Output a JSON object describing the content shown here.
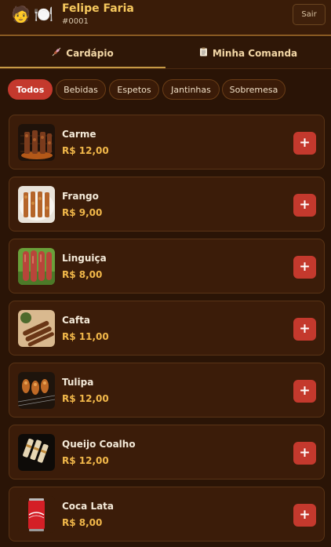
{
  "header": {
    "avatar_icon": "🧑",
    "plate_icon": "🍽️",
    "name": "Felipe Faria",
    "id": "#0001",
    "logout_label": "Sair"
  },
  "tabs": [
    {
      "label": "Cardápio",
      "icon": "skewer-icon",
      "active": true
    },
    {
      "label": "Minha Comanda",
      "icon": "clipboard-icon",
      "active": false
    }
  ],
  "categories": [
    {
      "label": "Todos",
      "active": true
    },
    {
      "label": "Bebidas",
      "active": false
    },
    {
      "label": "Espetos",
      "active": false
    },
    {
      "label": "Jantinhas",
      "active": false
    },
    {
      "label": "Sobremesa",
      "active": false
    }
  ],
  "products": [
    {
      "name": "Carme",
      "price": "R$ 12,00",
      "add_label": "+",
      "image": "grilled-meat-skewers"
    },
    {
      "name": "Frango",
      "price": "R$ 9,00",
      "add_label": "+",
      "image": "chicken-skewers"
    },
    {
      "name": "Linguiça",
      "price": "R$ 8,00",
      "add_label": "+",
      "image": "sausage-skewers"
    },
    {
      "name": "Cafta",
      "price": "R$ 11,00",
      "add_label": "+",
      "image": "kafta-skewers"
    },
    {
      "name": "Tulipa",
      "price": "R$ 12,00",
      "add_label": "+",
      "image": "chicken-drumette-skewers"
    },
    {
      "name": "Queijo Coalho",
      "price": "R$ 12,00",
      "add_label": "+",
      "image": "cheese-skewers"
    },
    {
      "name": "Coca Lata",
      "price": "R$ 8,00",
      "add_label": "+",
      "image": "coca-cola-can"
    }
  ],
  "colors": {
    "background": "#2a1406",
    "accent_red": "#c4392d",
    "price_gold": "#f2b84a",
    "name_gold": "#f7c95e"
  }
}
